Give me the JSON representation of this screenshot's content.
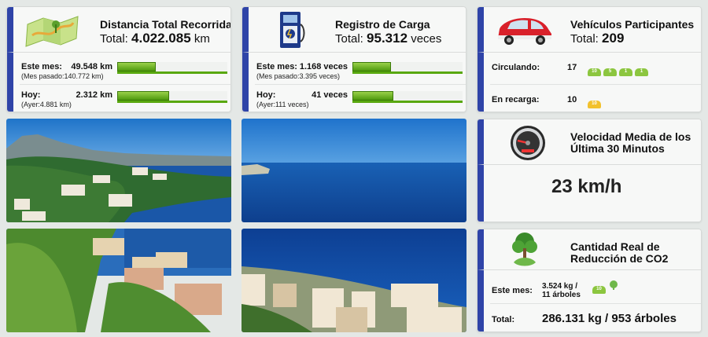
{
  "distance": {
    "title": "Distancia Total Recorrida",
    "total_label": "Total:",
    "total_value": "4.022.085",
    "total_unit": "km",
    "month_label": "Este mes:",
    "month_value": "49.548 km",
    "month_prev": "(Mes pasado:140.772 km)",
    "month_progress": 0.35,
    "today_label": "Hoy:",
    "today_value": "2.312 km",
    "today_prev": "(Ayer:4.881 km)",
    "today_progress": 0.47
  },
  "charging": {
    "title": "Registro de Carga",
    "total_label": "Total:",
    "total_value": "95.312",
    "total_unit": "veces",
    "month_label": "Este mes:",
    "month_value": "1.168 veces",
    "month_prev": "(Mes pasado:3.395 veces)",
    "month_progress": 0.35,
    "today_label": "Hoy:",
    "today_value": "41 veces",
    "today_prev": "(Ayer:111 veces)",
    "today_progress": 0.37
  },
  "vehicles": {
    "title": "Vehículos Participantes",
    "total_label": "Total:",
    "total_value": "209",
    "circulating_label": "Circulando:",
    "circulating_value": "17",
    "circulating_badges": [
      "10",
      "5",
      "1",
      "1"
    ],
    "charging_label": "En recarga:",
    "charging_value": "10",
    "charging_badges": [
      "10"
    ]
  },
  "speed": {
    "title_line1": "Velocidad Media de los",
    "title_line2": "Última 30 Minutos",
    "value": "23 km/h"
  },
  "co2": {
    "title_line1": "Cantidad Real de",
    "title_line2": "Reducción de CO2",
    "month_label": "Este mes:",
    "month_value_line1": "3.524 kg /",
    "month_value_line2": "11 árboles",
    "month_badge": "10",
    "total_label": "Total:",
    "total_value": "286.131 kg / 953 árboles"
  },
  "colors": {
    "accent_blue": "#2f44a8",
    "bar_green": "#59a80f",
    "car_green": "#8cc63f",
    "car_yellow": "#f2c12e"
  }
}
